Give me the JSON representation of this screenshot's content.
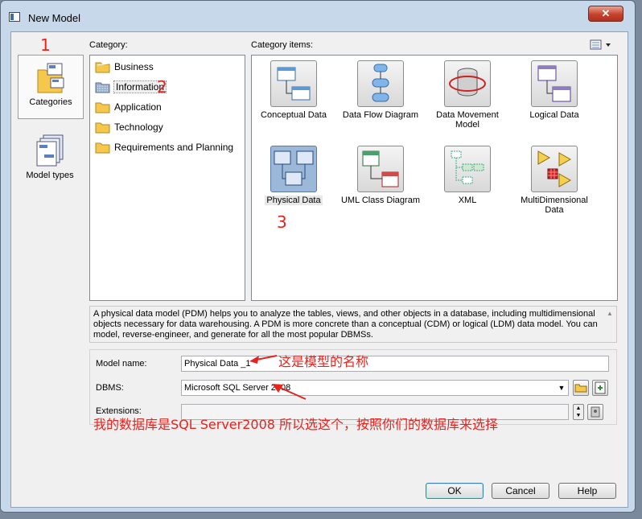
{
  "window": {
    "title": "New Model",
    "close_label": "✕"
  },
  "left_panel": {
    "items": [
      {
        "label": "Categories",
        "icon": "categories-folder-icon",
        "selected": true
      },
      {
        "label": "Model types",
        "icon": "model-types-icon",
        "selected": false
      }
    ]
  },
  "category": {
    "label": "Category:",
    "items": [
      {
        "label": "Business"
      },
      {
        "label": "Information",
        "selected": true
      },
      {
        "label": "Application"
      },
      {
        "label": "Technology"
      },
      {
        "label": "Requirements and Planning"
      }
    ]
  },
  "category_items": {
    "label": "Category items:",
    "items": [
      {
        "label": "Conceptual Data",
        "icon": "conceptual-data-icon"
      },
      {
        "label": "Data Flow Diagram",
        "icon": "data-flow-diagram-icon"
      },
      {
        "label": "Data Movement Model",
        "icon": "data-movement-model-icon"
      },
      {
        "label": "Logical Data",
        "icon": "logical-data-icon"
      },
      {
        "label": "Physical Data",
        "icon": "physical-data-icon",
        "selected": true
      },
      {
        "label": "UML Class Diagram",
        "icon": "uml-class-diagram-icon"
      },
      {
        "label": "XML",
        "icon": "xml-icon"
      },
      {
        "label": "MultiDimensional Data",
        "icon": "multidimensional-data-icon"
      }
    ]
  },
  "description": "A physical data model (PDM) helps you to analyze the tables, views, and other objects in a database, including multidimensional objects necessary for data warehousing. A PDM is more concrete than a conceptual (CDM) or logical (LDM) data model. You can model, reverse-engineer, and generate for all the most popular DBMSs.",
  "form": {
    "model_name_label": "Model name:",
    "model_name_value": "Physical Data _1",
    "dbms_label": "DBMS:",
    "dbms_value": "Microsoft SQL Server 2008",
    "extensions_label": "Extensions:"
  },
  "buttons": {
    "ok": "OK",
    "cancel": "Cancel",
    "help": "Help"
  },
  "annotations": {
    "n1": "1",
    "n2": "2",
    "n3": "3",
    "model_name_note": "这是模型的名称",
    "dbms_note": "我的数据库是SQL Server2008 所以选这个，按照你们的数据库来选择"
  },
  "colors": {
    "annotation": "#e8231f",
    "close_button": "#c6412b"
  }
}
